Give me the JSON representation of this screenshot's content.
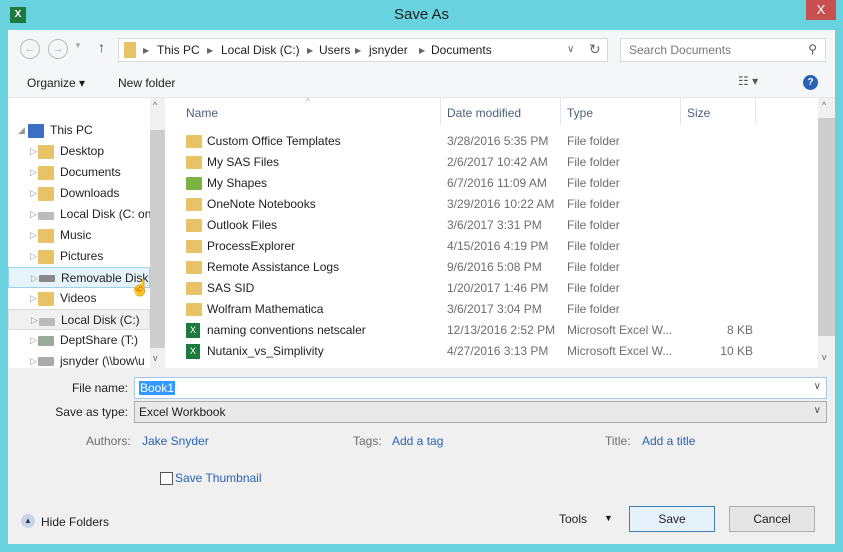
{
  "window": {
    "title": "Save As",
    "close": "X",
    "app_icon": "X"
  },
  "address": {
    "crumbs": [
      "This PC",
      "Local Disk (C:)",
      "Users",
      "jsnyder",
      "Documents"
    ],
    "search_placeholder": "Search Documents"
  },
  "toolbar": {
    "organize": "Organize ▾",
    "new_folder": "New folder",
    "help": "?"
  },
  "nav": {
    "items": [
      {
        "label": "This PC",
        "expanded": true
      },
      {
        "label": "Desktop"
      },
      {
        "label": "Documents"
      },
      {
        "label": "Downloads"
      },
      {
        "label": "Local Disk (C: on"
      },
      {
        "label": "Music"
      },
      {
        "label": "Pictures"
      },
      {
        "label": "Removable Disk (",
        "hovered": true
      },
      {
        "label": "Videos"
      },
      {
        "label": "Local Disk (C:)",
        "selected": true
      },
      {
        "label": "DeptShare (T:)"
      },
      {
        "label": "jsnyder (\\\\bow\\u"
      }
    ]
  },
  "columns": {
    "name": "Name",
    "date": "Date modified",
    "type": "Type",
    "size": "Size"
  },
  "files": [
    {
      "name": "Custom Office Templates",
      "date": "3/28/2016 5:35 PM",
      "type": "File folder",
      "size": "",
      "icon": "folder"
    },
    {
      "name": "My SAS Files",
      "date": "2/6/2017 10:42 AM",
      "type": "File folder",
      "size": "",
      "icon": "folder"
    },
    {
      "name": "My Shapes",
      "date": "6/7/2016 11:09 AM",
      "type": "File folder",
      "size": "",
      "icon": "shapes-folder"
    },
    {
      "name": "OneNote Notebooks",
      "date": "3/29/2016 10:22 AM",
      "type": "File folder",
      "size": "",
      "icon": "folder"
    },
    {
      "name": "Outlook Files",
      "date": "3/6/2017 3:31 PM",
      "type": "File folder",
      "size": "",
      "icon": "folder"
    },
    {
      "name": "ProcessExplorer",
      "date": "4/15/2016 4:19 PM",
      "type": "File folder",
      "size": "",
      "icon": "folder"
    },
    {
      "name": "Remote Assistance Logs",
      "date": "9/6/2016 5:08 PM",
      "type": "File folder",
      "size": "",
      "icon": "folder"
    },
    {
      "name": "SAS SID",
      "date": "1/20/2017 1:46 PM",
      "type": "File folder",
      "size": "",
      "icon": "folder"
    },
    {
      "name": "Wolfram Mathematica",
      "date": "3/6/2017 3:04 PM",
      "type": "File folder",
      "size": "",
      "icon": "folder"
    },
    {
      "name": "naming conventions netscaler",
      "date": "12/13/2016 2:52 PM",
      "type": "Microsoft Excel W...",
      "size": "8 KB",
      "icon": "excel"
    },
    {
      "name": "Nutanix_vs_Simplivity",
      "date": "4/27/2016 3:13 PM",
      "type": "Microsoft Excel W...",
      "size": "10 KB",
      "icon": "excel"
    }
  ],
  "form": {
    "file_name_label": "File name:",
    "file_name": "Book1",
    "type_label": "Save as type:",
    "type_value": "Excel Workbook",
    "authors_label": "Authors:",
    "authors": "Jake Snyder",
    "tags_label": "Tags:",
    "tags": "Add a tag",
    "title_label": "Title:",
    "title": "Add a title",
    "thumbnail": "Save Thumbnail",
    "thumbnail_checked": false
  },
  "footer": {
    "hide_folders": "Hide Folders",
    "tools": "Tools",
    "save": "Save",
    "cancel": "Cancel"
  }
}
